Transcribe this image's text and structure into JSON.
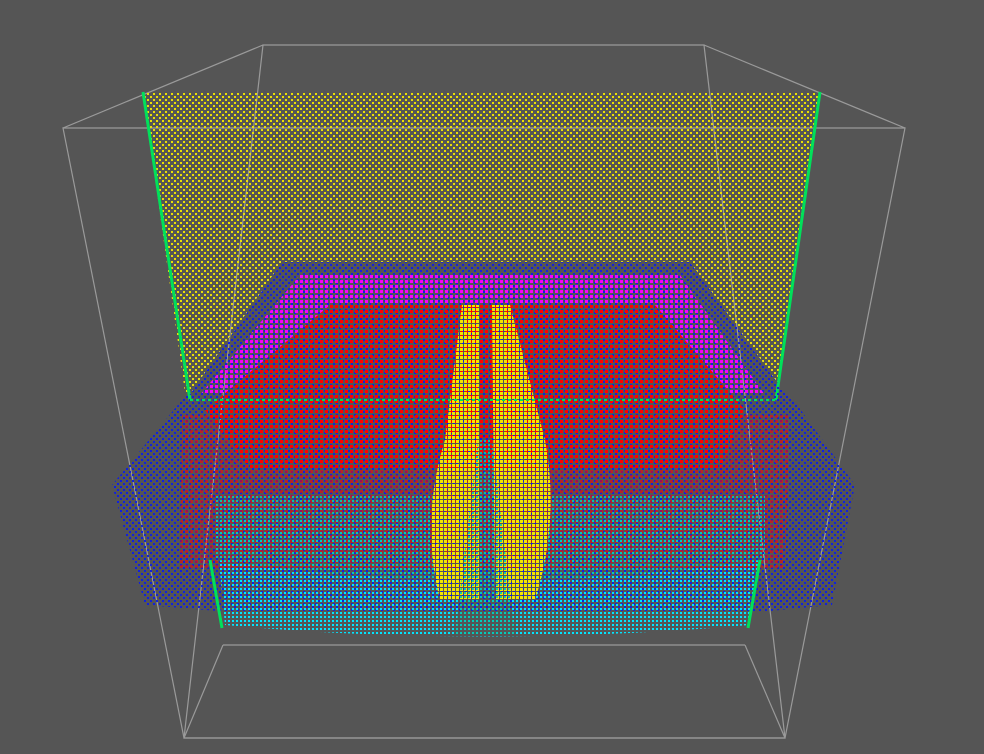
{
  "scene": {
    "background_color": "#555555",
    "bounding_box_color": "#9a9a9a",
    "point_cloud": {
      "colors": {
        "yellow": "#f2e600",
        "green": "#00e05a",
        "blue": "#1020e0",
        "magenta": "#ff00ff",
        "red": "#ff0000",
        "cyan": "#00e5ff",
        "teal": "#00c8b4"
      }
    }
  }
}
